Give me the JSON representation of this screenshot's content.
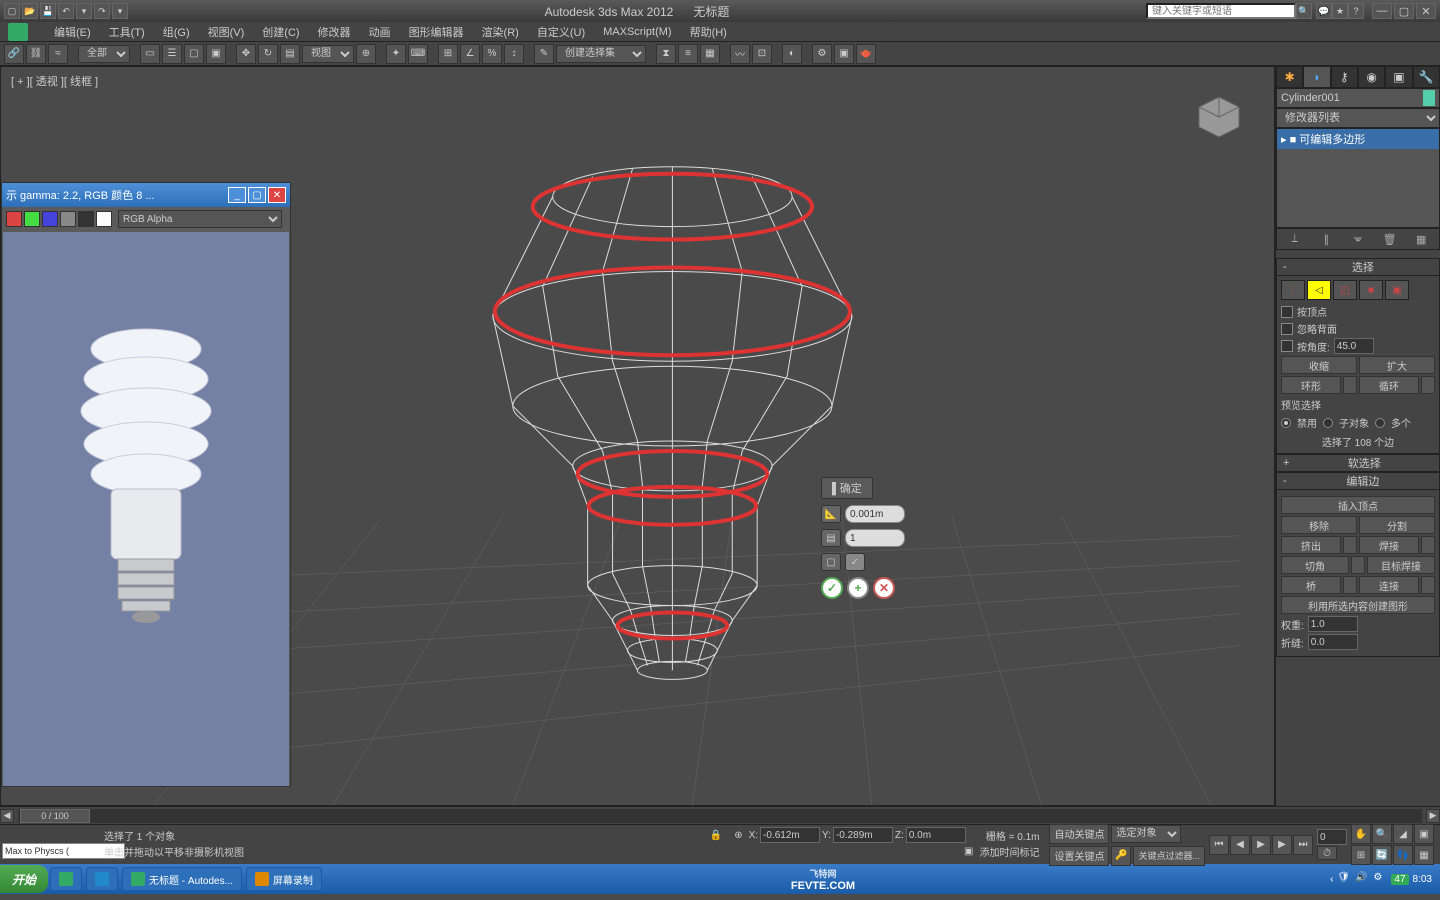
{
  "titlebar": {
    "app": "Autodesk 3ds Max 2012",
    "doc": "无标题",
    "search_placeholder": "键入关键字或短语"
  },
  "menu": {
    "edit": "编辑(E)",
    "tools": "工具(T)",
    "group": "组(G)",
    "views": "视图(V)",
    "create": "创建(C)",
    "modifiers": "修改器",
    "animation": "动画",
    "graph": "图形编辑器",
    "render": "渲染(R)",
    "customize": "自定义(U)",
    "maxscript": "MAXScript(M)",
    "help": "帮助(H)"
  },
  "toolbar": {
    "all": "全部",
    "view": "视图",
    "selection_set": "创建选择集"
  },
  "viewport": {
    "label": "[ + ][ 透视 ][ 线框 ]"
  },
  "floating": {
    "confirm": "▌确定",
    "distance": "0.001m",
    "segments": "1"
  },
  "command_panel": {
    "object_name": "Cylinder001",
    "modifier_list_label": "修改器列表",
    "modifier_item": "可编辑多边形",
    "rollouts": {
      "selection": "选择",
      "by_vertex": "按顶点",
      "ignore_backfacing": "忽略背面",
      "by_angle": "按角度:",
      "angle_value": "45.0",
      "shrink": "收缩",
      "grow": "扩大",
      "ring": "环形",
      "loop": "循环",
      "preview_sel": "预览选择",
      "pv_off": "禁用",
      "pv_sub": "子对象",
      "pv_multi": "多个",
      "sel_status": "选择了 108 个边",
      "soft_sel": "软选择",
      "edit_edges": "编辑边",
      "insert_vert": "插入顶点",
      "remove": "移除",
      "split": "分割",
      "extrude": "挤出",
      "weld": "焊接",
      "chamfer": "切角",
      "target_weld": "目标焊接",
      "bridge": "桥",
      "connect": "连接",
      "create_shape": "利用所选内容创建图形",
      "weight": "权重:",
      "weight_val": "1.0",
      "crease": "折缝:",
      "crease_val": "0.0"
    }
  },
  "render_window": {
    "title": "示 gamma: 2.2, RGB 颜色 8 ...",
    "channel": "RGB Alpha"
  },
  "timeline": {
    "frame": "0 / 100"
  },
  "status": {
    "script_label": "Max to Physcs (",
    "selection": "选择了 1 个对象",
    "hint": "单击并拖动以平移非摄影机视图",
    "x": "-0.612m",
    "y": "-0.289m",
    "z": "0.0m",
    "grid": "栅格 = 0.1m",
    "autokey": "自动关键点",
    "selected": "选定对象",
    "setkey": "设置关键点",
    "keyfilters": "关键点过滤器...",
    "addtime": "添加时间标记"
  },
  "taskbar": {
    "start": "开始",
    "item1": "无标题 - Autodes...",
    "item2": "屏幕录制",
    "center": "FEVTE.COM",
    "subcenter": "飞特网",
    "temp": "47",
    "time": "8:03"
  }
}
